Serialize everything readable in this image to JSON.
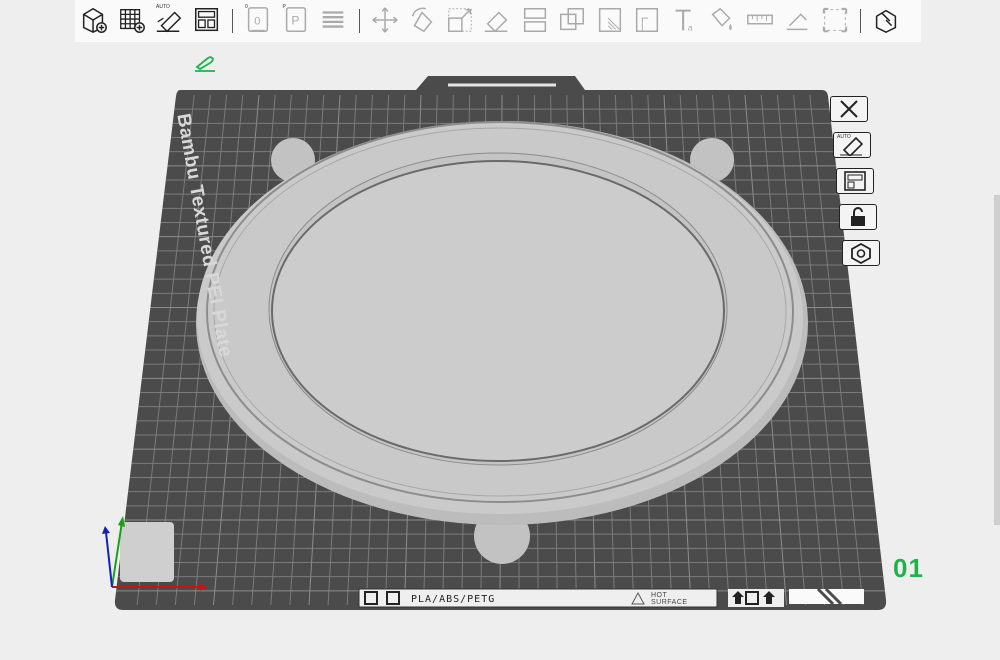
{
  "toolbar": {
    "groups": [
      [
        {
          "name": "add-object-icon"
        },
        {
          "name": "add-plate-icon"
        },
        {
          "name": "auto-orient-icon",
          "label": "AUTO"
        },
        {
          "name": "arrange-icon"
        }
      ],
      [
        {
          "name": "plate-slice-icon",
          "label": "0"
        },
        {
          "name": "plate-print-icon",
          "label": "P"
        },
        {
          "name": "layers-icon"
        }
      ],
      [
        {
          "name": "move-icon"
        },
        {
          "name": "rotate-icon"
        },
        {
          "name": "scale-icon"
        },
        {
          "name": "lay-on-face-icon"
        },
        {
          "name": "cut-icon"
        },
        {
          "name": "boolean-icon"
        },
        {
          "name": "support-paint-icon"
        },
        {
          "name": "seam-paint-icon"
        },
        {
          "name": "text-icon"
        },
        {
          "name": "color-paint-icon"
        },
        {
          "name": "measure-icon"
        },
        {
          "name": "assembly-icon"
        },
        {
          "name": "variable-layer-icon"
        }
      ],
      [
        {
          "name": "assembly-view-icon"
        }
      ]
    ]
  },
  "plate": {
    "name": "Bambu Textured PEI Plate",
    "number": "01",
    "material": "PLA/ABS/PETG",
    "hot_surface": [
      "HOT",
      "SURFACE"
    ],
    "colors": {
      "bed": "#4a4b4a",
      "grid": "#7a7b7a",
      "model": "#c8c8c8",
      "plate_number": "#1fb14a",
      "background": "#eeeeee"
    }
  },
  "side_buttons": [
    {
      "name": "remove-plate-icon"
    },
    {
      "name": "auto-orient-plate-icon",
      "label": "AUTO"
    },
    {
      "name": "arrange-plate-icon"
    },
    {
      "name": "lock-plate-icon"
    },
    {
      "name": "plate-settings-icon"
    }
  ]
}
